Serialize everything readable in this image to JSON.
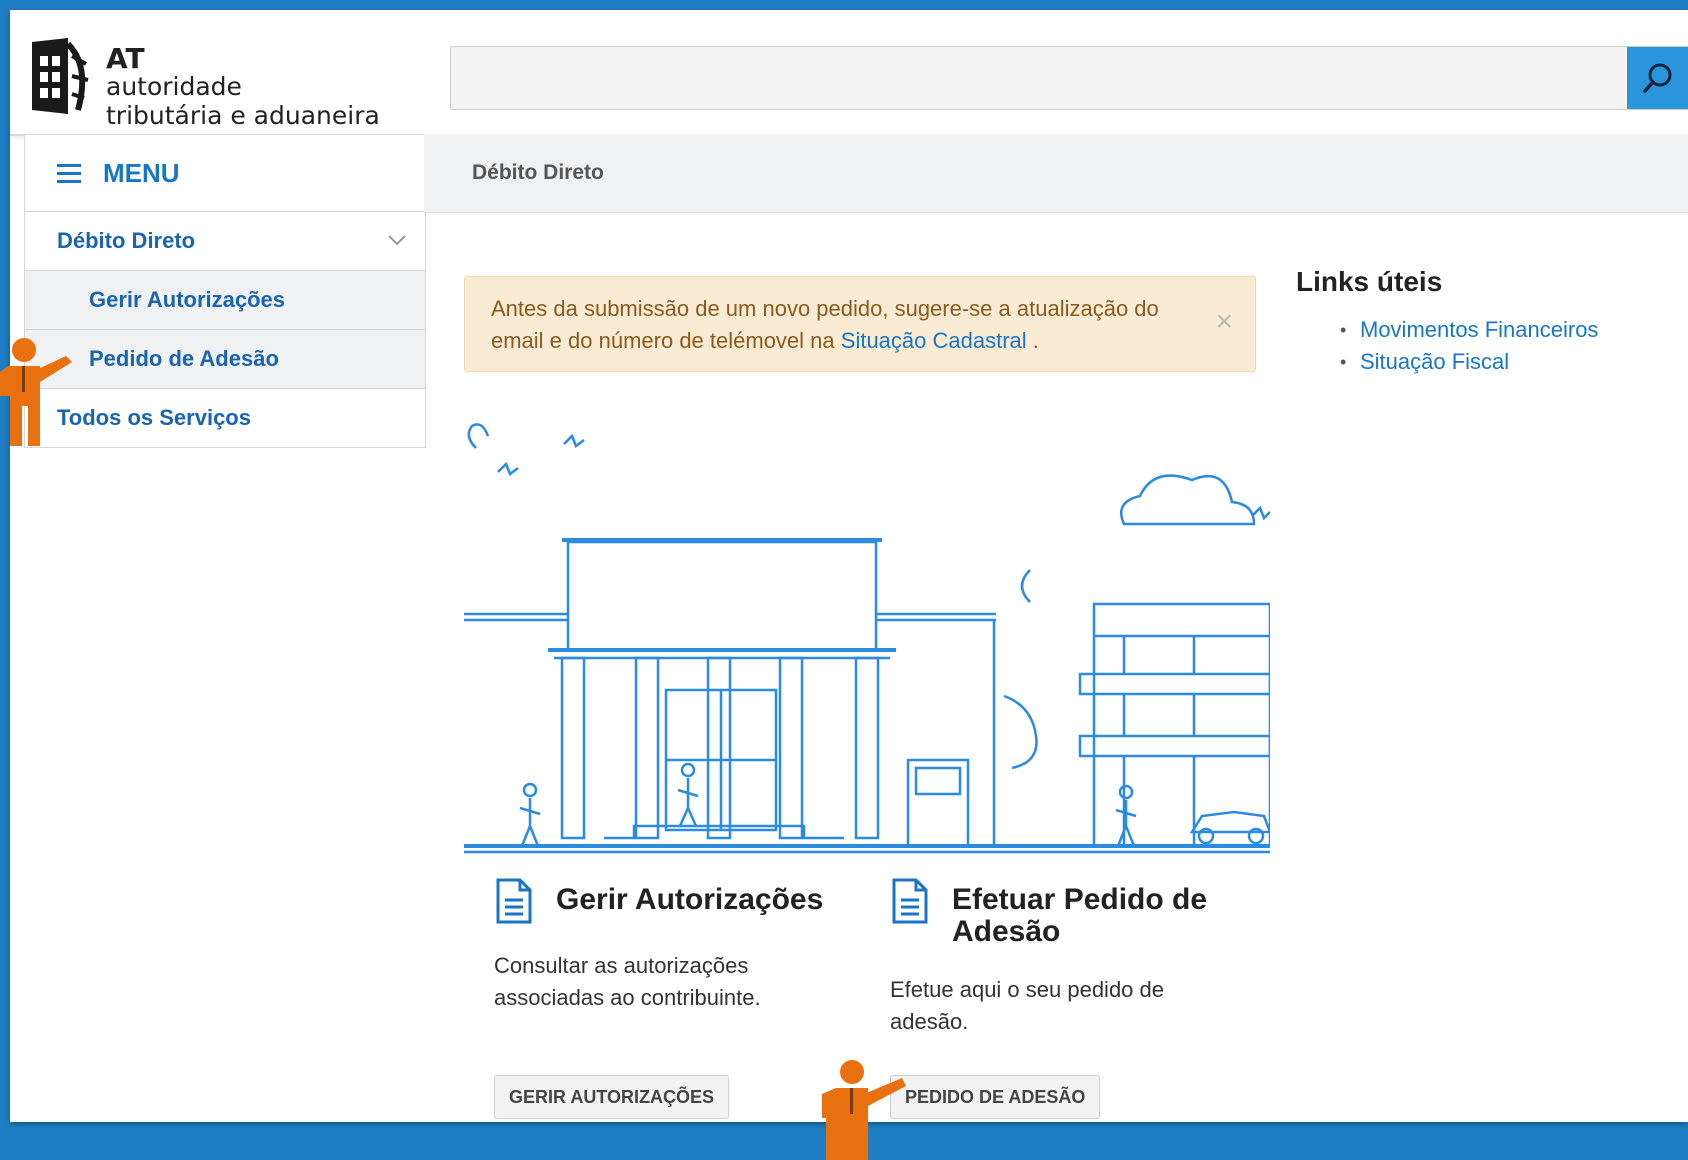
{
  "header": {
    "logo": {
      "abbr": "AT",
      "line1": "autoridade",
      "line2": "tributária e aduaneira"
    },
    "search": {
      "placeholder": "",
      "value": ""
    }
  },
  "sidebar": {
    "menu_label": "MENU",
    "items": [
      {
        "label": "Débito Direto"
      },
      {
        "label": "Gerir Autorizações"
      },
      {
        "label": "Pedido de Adesão"
      },
      {
        "label": "Todos os Serviços"
      }
    ]
  },
  "breadcrumb": {
    "current": "Débito Direto"
  },
  "alert": {
    "text_before": "Antes da submissão de um novo pedido, sugere-se a atualização do email e do número de telémovel na ",
    "link_text": "Situação Cadastral",
    "text_after": " .",
    "close": "×"
  },
  "cards": [
    {
      "title": "Gerir Autorizações",
      "description": "Consultar as autorizações associadas ao contribuinte.",
      "button": "GERIR AUTORIZAÇÕES"
    },
    {
      "title": "Efetuar Pedido de Adesão",
      "description": "Efetue aqui o seu pedido de adesão.",
      "button": "PEDIDO DE ADESÃO"
    }
  ],
  "links": {
    "title": "Links úteis",
    "items": [
      "Movimentos Financeiros",
      "Situação Fiscal"
    ]
  },
  "colors": {
    "accent": "#1976c5",
    "frame": "#1f7fc4",
    "alert_bg": "#faecd4",
    "pointer": "#e8700f"
  }
}
